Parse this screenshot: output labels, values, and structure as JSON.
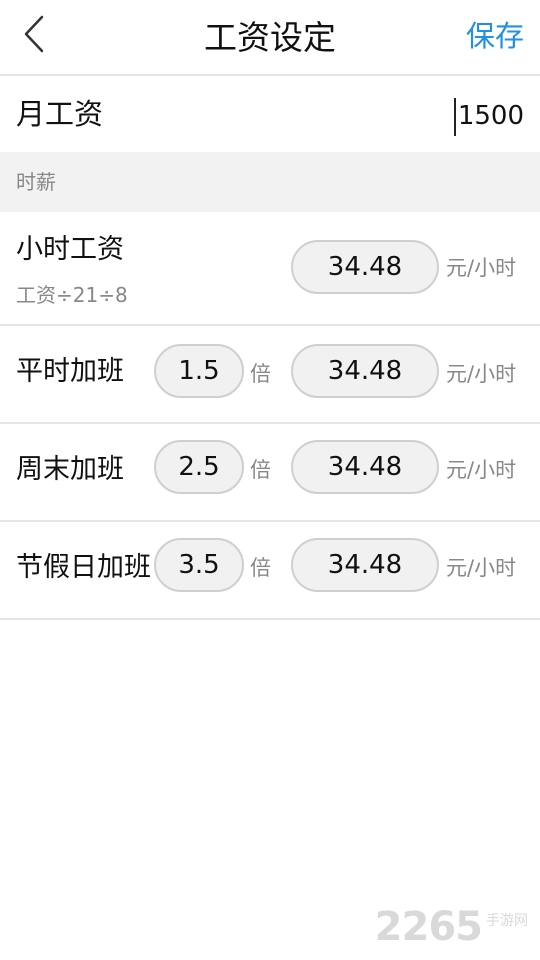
{
  "header": {
    "title": "工资设定",
    "save_label": "保存"
  },
  "monthly_salary": {
    "label": "月工资",
    "value": "1500"
  },
  "section": {
    "label": "时薪"
  },
  "hourly": {
    "title": "小时工资",
    "formula": "工资÷21÷8",
    "value": "34.48",
    "unit": "元/小时"
  },
  "overtime_rows": [
    {
      "title": "平时加班",
      "multiplier": "1.5",
      "times_label": "倍",
      "value": "34.48",
      "unit": "元/小时"
    },
    {
      "title": "周末加班",
      "multiplier": "2.5",
      "times_label": "倍",
      "value": "34.48",
      "unit": "元/小时"
    },
    {
      "title": "节假日加班",
      "multiplier": "3.5",
      "times_label": "倍",
      "value": "34.48",
      "unit": "元/小时"
    }
  ],
  "watermark": {
    "number": "2265",
    "site": "手游网"
  }
}
